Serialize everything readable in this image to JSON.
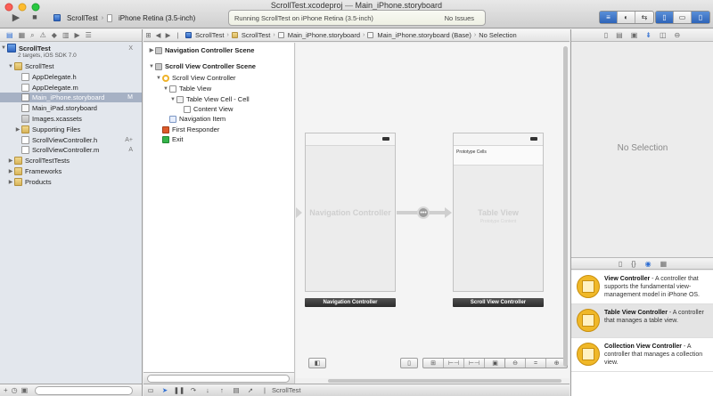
{
  "window": {
    "title_file": "ScrollTest.xcodeproj",
    "title_sep": "—",
    "title_doc": "Main_iPhone.storyboard"
  },
  "toolbar": {
    "run_icon": "▶",
    "stop_icon": "■",
    "scheme": "ScrollTest",
    "destination": "iPhone Retina (3.5-inch)",
    "activity_status": "Running ScrollTest on iPhone Retina (3.5-inch)",
    "activity_issues": "No Issues"
  },
  "navigator": {
    "project_name": "ScrollTest",
    "project_sub": "2 targets, iOS SDK 7.0",
    "items": [
      {
        "label": "ScrollTest",
        "type": "folder",
        "indent": 1,
        "disclosure": "▼",
        "badge": ""
      },
      {
        "label": "AppDelegate.h",
        "type": "h",
        "indent": 2,
        "disclosure": "",
        "badge": ""
      },
      {
        "label": "AppDelegate.m",
        "type": "m",
        "indent": 2,
        "disclosure": "",
        "badge": ""
      },
      {
        "label": "Main_iPhone.storyboard",
        "type": "sb",
        "indent": 2,
        "disclosure": "",
        "badge": "M"
      },
      {
        "label": "Main_iPad.storyboard",
        "type": "sb",
        "indent": 2,
        "disclosure": "",
        "badge": ""
      },
      {
        "label": "Images.xcassets",
        "type": "assets",
        "indent": 2,
        "disclosure": "",
        "badge": ""
      },
      {
        "label": "Supporting Files",
        "type": "folder",
        "indent": 2,
        "disclosure": "▶",
        "badge": ""
      },
      {
        "label": "ScrollViewController.h",
        "type": "h",
        "indent": 2,
        "disclosure": "",
        "badge": "A+"
      },
      {
        "label": "ScrollViewController.m",
        "type": "m",
        "indent": 2,
        "disclosure": "",
        "badge": "A"
      },
      {
        "label": "ScrollTestTests",
        "type": "folder",
        "indent": 1,
        "disclosure": "▶",
        "badge": ""
      },
      {
        "label": "Frameworks",
        "type": "folder",
        "indent": 1,
        "disclosure": "▶",
        "badge": ""
      },
      {
        "label": "Products",
        "type": "folder",
        "indent": 1,
        "disclosure": "▶",
        "badge": ""
      }
    ],
    "project_badge": "X"
  },
  "jumpbar": {
    "crumbs": [
      "ScrollTest",
      "ScrollTest",
      "Main_iPhone.storyboard",
      "Main_iPhone.storyboard (Base)",
      "No Selection"
    ]
  },
  "outline": {
    "items": [
      {
        "label": "Navigation Controller Scene",
        "type": "scene",
        "indent": 0,
        "disclosure": "▶",
        "bold": true
      },
      {
        "label": "Scroll View Controller Scene",
        "type": "scene",
        "indent": 0,
        "disclosure": "▼",
        "bold": true
      },
      {
        "label": "Scroll View Controller",
        "type": "vc",
        "indent": 1,
        "disclosure": "▼",
        "bold": false
      },
      {
        "label": "Table View",
        "type": "view",
        "indent": 2,
        "disclosure": "▼",
        "bold": false
      },
      {
        "label": "Table View Cell - Cell",
        "type": "cell",
        "indent": 3,
        "disclosure": "▼",
        "bold": false
      },
      {
        "label": "Content View",
        "type": "view",
        "indent": 4,
        "disclosure": "",
        "bold": false
      },
      {
        "label": "Navigation Item",
        "type": "navitem",
        "indent": 2,
        "disclosure": "",
        "bold": false
      },
      {
        "label": "First Responder",
        "type": "fr",
        "indent": 1,
        "disclosure": "",
        "bold": false
      },
      {
        "label": "Exit",
        "type": "exit",
        "indent": 1,
        "disclosure": "",
        "bold": false
      }
    ]
  },
  "canvas": {
    "nav_screen_title": "Navigation Controller",
    "table_screen_title": "Table View",
    "table_screen_sub": "Prototype Content",
    "prototype_cells": "Prototype Cells",
    "nav_scene_label": "Navigation Controller",
    "scroll_scene_label": "Scroll View Controller",
    "segue_glyph": "•••"
  },
  "utilities": {
    "no_selection": "No Selection",
    "library": [
      {
        "title": "View Controller",
        "desc": " - A controller that supports the fundamental view-management model in iPhone OS.",
        "icon": "view-controller-icon"
      },
      {
        "title": "Table View Controller",
        "desc": " - A controller that manages a table view.",
        "icon": "table-view-controller-icon"
      },
      {
        "title": "Collection View Controller",
        "desc": " - A controller that manages a collection view.",
        "icon": "collection-view-controller-icon"
      }
    ]
  },
  "debugbar": {
    "target": "ScrollTest"
  },
  "colors": {
    "accent": "#2e6ed3",
    "selection": "#a6b1c4",
    "library_icon": "#f0b828"
  }
}
